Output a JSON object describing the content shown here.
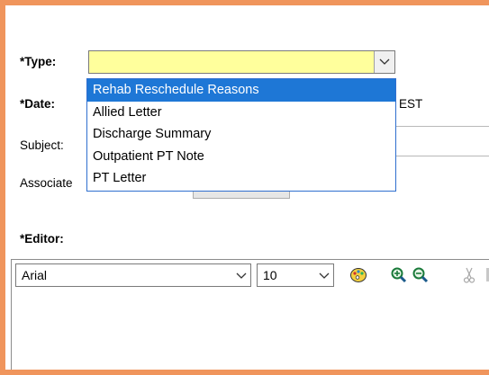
{
  "form": {
    "type_label": "*Type:",
    "date_label": "*Date:",
    "subject_label": "Subject:",
    "associate_label": "Associate",
    "editor_label": "*Editor:",
    "timezone": "EST",
    "type_value": ""
  },
  "type_dropdown": {
    "options": [
      "Rehab Reschedule Reasons",
      "Allied Letter",
      "Discharge Summary",
      "Outpatient PT Note",
      "PT Letter"
    ],
    "highlighted_index": 0
  },
  "toolbar": {
    "font_family": "Arial",
    "font_size": "10"
  },
  "colors": {
    "frame_border": "#f0955c",
    "type_field_bg": "#ffff9c",
    "selection_bg": "#1e77d6"
  }
}
